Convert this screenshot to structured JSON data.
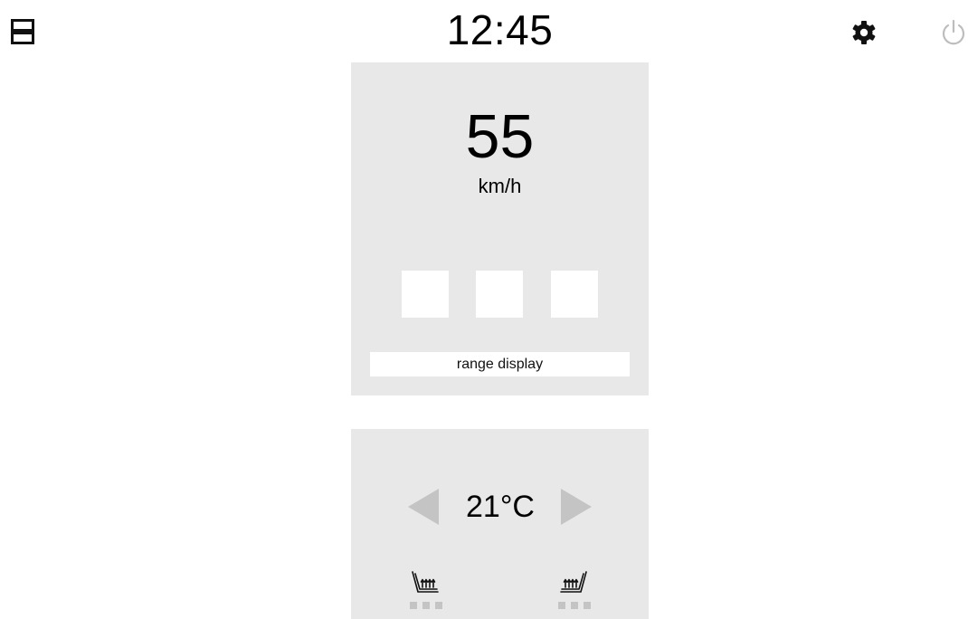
{
  "header": {
    "time": "12:45",
    "icons": {
      "layout": "split-layout-icon",
      "settings": "gear-icon",
      "power": "power-icon"
    }
  },
  "speed_panel": {
    "speed": "55",
    "unit": "km/h",
    "range_label": "range display"
  },
  "climate_panel": {
    "temperature": "21°C",
    "seat_heat_left_level": 0,
    "seat_heat_right_level": 0
  },
  "colors": {
    "panel_bg": "#e8e8e8",
    "inactive": "#c4c4c4",
    "power_icon": "#bdbdbd"
  }
}
